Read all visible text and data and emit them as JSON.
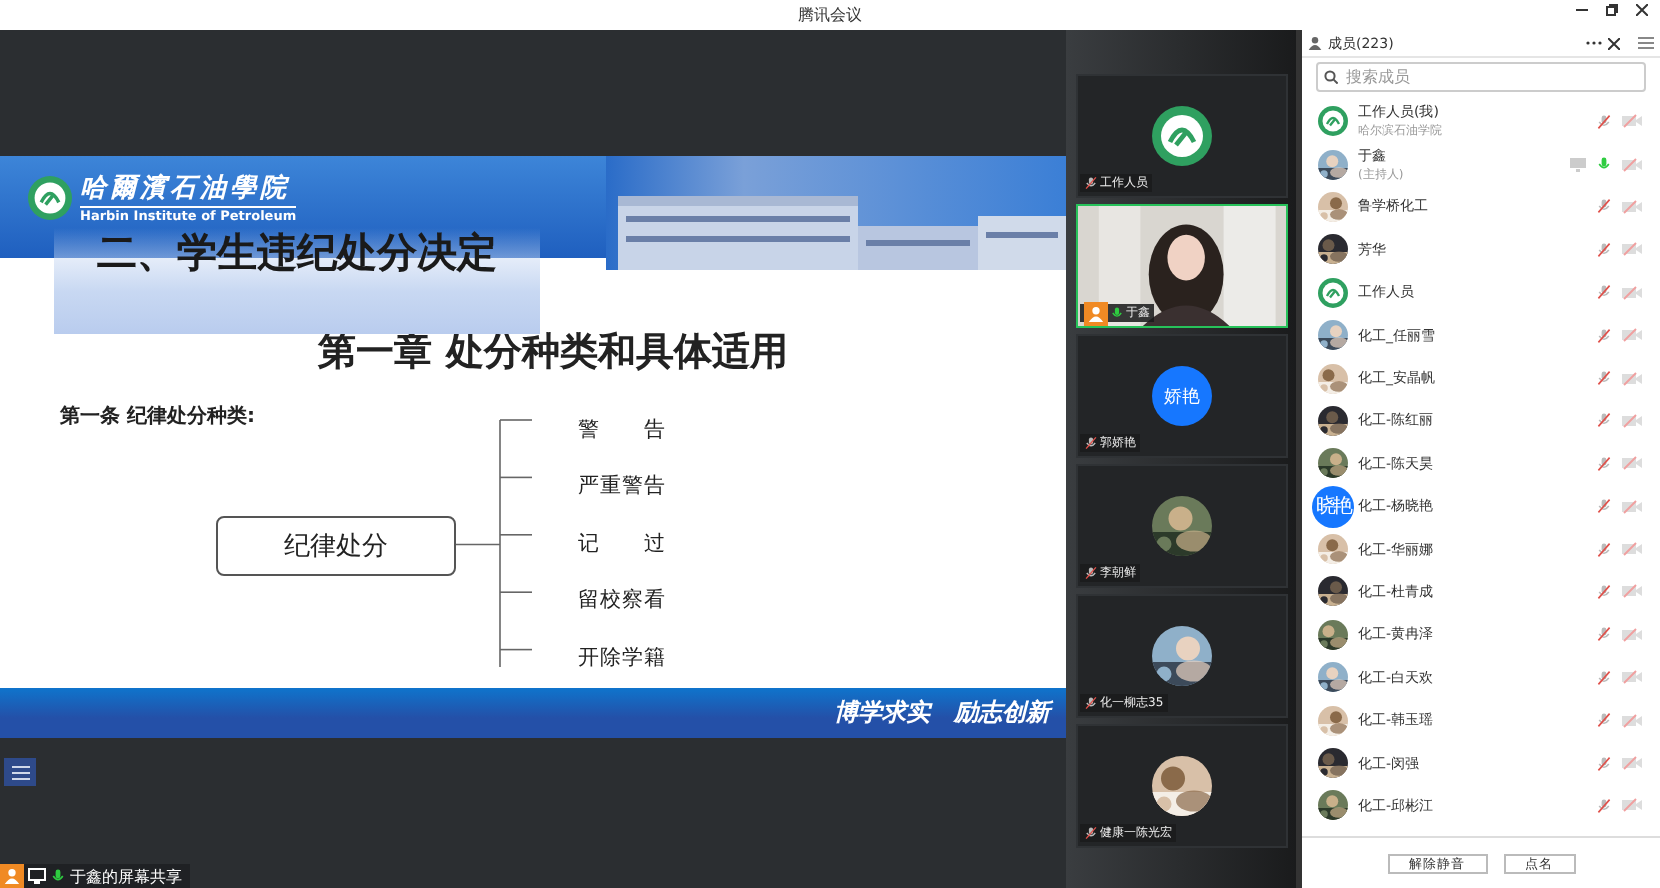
{
  "window": {
    "title": "腾讯会议"
  },
  "slide": {
    "school_name": "哈爾濱石油學院",
    "school_name_en": "Harbin Institute of Petroleum",
    "title": "二、学生违纪处分决定",
    "chapter": "第一章 处分种类和具体适用",
    "article": "第一条 纪律处分种类:",
    "category": "纪律处分",
    "items": [
      "警　　告",
      "严重警告",
      "记　　过",
      "留校察看",
      "开除学籍"
    ],
    "motto": "博学求实　励志创新"
  },
  "share_label": "于鑫的屏幕共享",
  "video_tiles": [
    {
      "name": "工作人员",
      "kind": "logo",
      "muted": true,
      "selected": false
    },
    {
      "name": "于鑫",
      "kind": "camera",
      "muted": false,
      "selected": true
    },
    {
      "name": "郭娇艳",
      "kind": "initials",
      "initials": "娇艳",
      "muted": true,
      "selected": false
    },
    {
      "name": "李朝鲜",
      "kind": "picture",
      "muted": true,
      "selected": false
    },
    {
      "name": "化一柳志35",
      "kind": "picture",
      "muted": true,
      "selected": false
    },
    {
      "name": "健康一陈光宏",
      "kind": "picture",
      "muted": true,
      "selected": false
    }
  ],
  "members": {
    "title": "成员(223)",
    "search": {
      "placeholder": "搜索成员"
    },
    "list": [
      {
        "name": "工作人员(我)",
        "subtitle": "哈尔滨石油学院",
        "kind": "logo",
        "muted": true,
        "sharing": false
      },
      {
        "name": "于鑫",
        "subtitle": "(主持人)",
        "kind": "picture",
        "muted": false,
        "sharing": true
      },
      {
        "name": "鲁学桥化工",
        "kind": "picture",
        "muted": true,
        "sharing": false
      },
      {
        "name": "芳华",
        "kind": "picture",
        "muted": true,
        "sharing": false
      },
      {
        "name": "工作人员",
        "kind": "logo",
        "muted": true,
        "sharing": false
      },
      {
        "name": "化工_任丽雪",
        "kind": "picture",
        "muted": true,
        "sharing": false
      },
      {
        "name": "化工_安晶帆",
        "kind": "picture",
        "muted": true,
        "sharing": false
      },
      {
        "name": "化工-陈红丽",
        "kind": "picture",
        "muted": true,
        "sharing": false
      },
      {
        "name": "化工-陈天昊",
        "kind": "picture",
        "muted": true,
        "sharing": false
      },
      {
        "name": "化工-杨晓艳",
        "kind": "initials",
        "initials": "晓艳",
        "muted": true,
        "sharing": false
      },
      {
        "name": "化工-华丽娜",
        "kind": "picture",
        "muted": true,
        "sharing": false
      },
      {
        "name": "化工-杜青成",
        "kind": "picture",
        "muted": true,
        "sharing": false
      },
      {
        "name": "化工-黄冉泽",
        "kind": "picture",
        "muted": true,
        "sharing": false
      },
      {
        "name": "化工-白天欢",
        "kind": "picture",
        "muted": true,
        "sharing": false
      },
      {
        "name": "化工-韩玉瑶",
        "kind": "picture",
        "muted": true,
        "sharing": false
      },
      {
        "name": "化工-闵强",
        "kind": "picture",
        "muted": true,
        "sharing": false
      },
      {
        "name": "化工-邱彬江",
        "kind": "picture",
        "muted": true,
        "sharing": false
      }
    ],
    "buttons": [
      "解除静音",
      "点名"
    ]
  }
}
